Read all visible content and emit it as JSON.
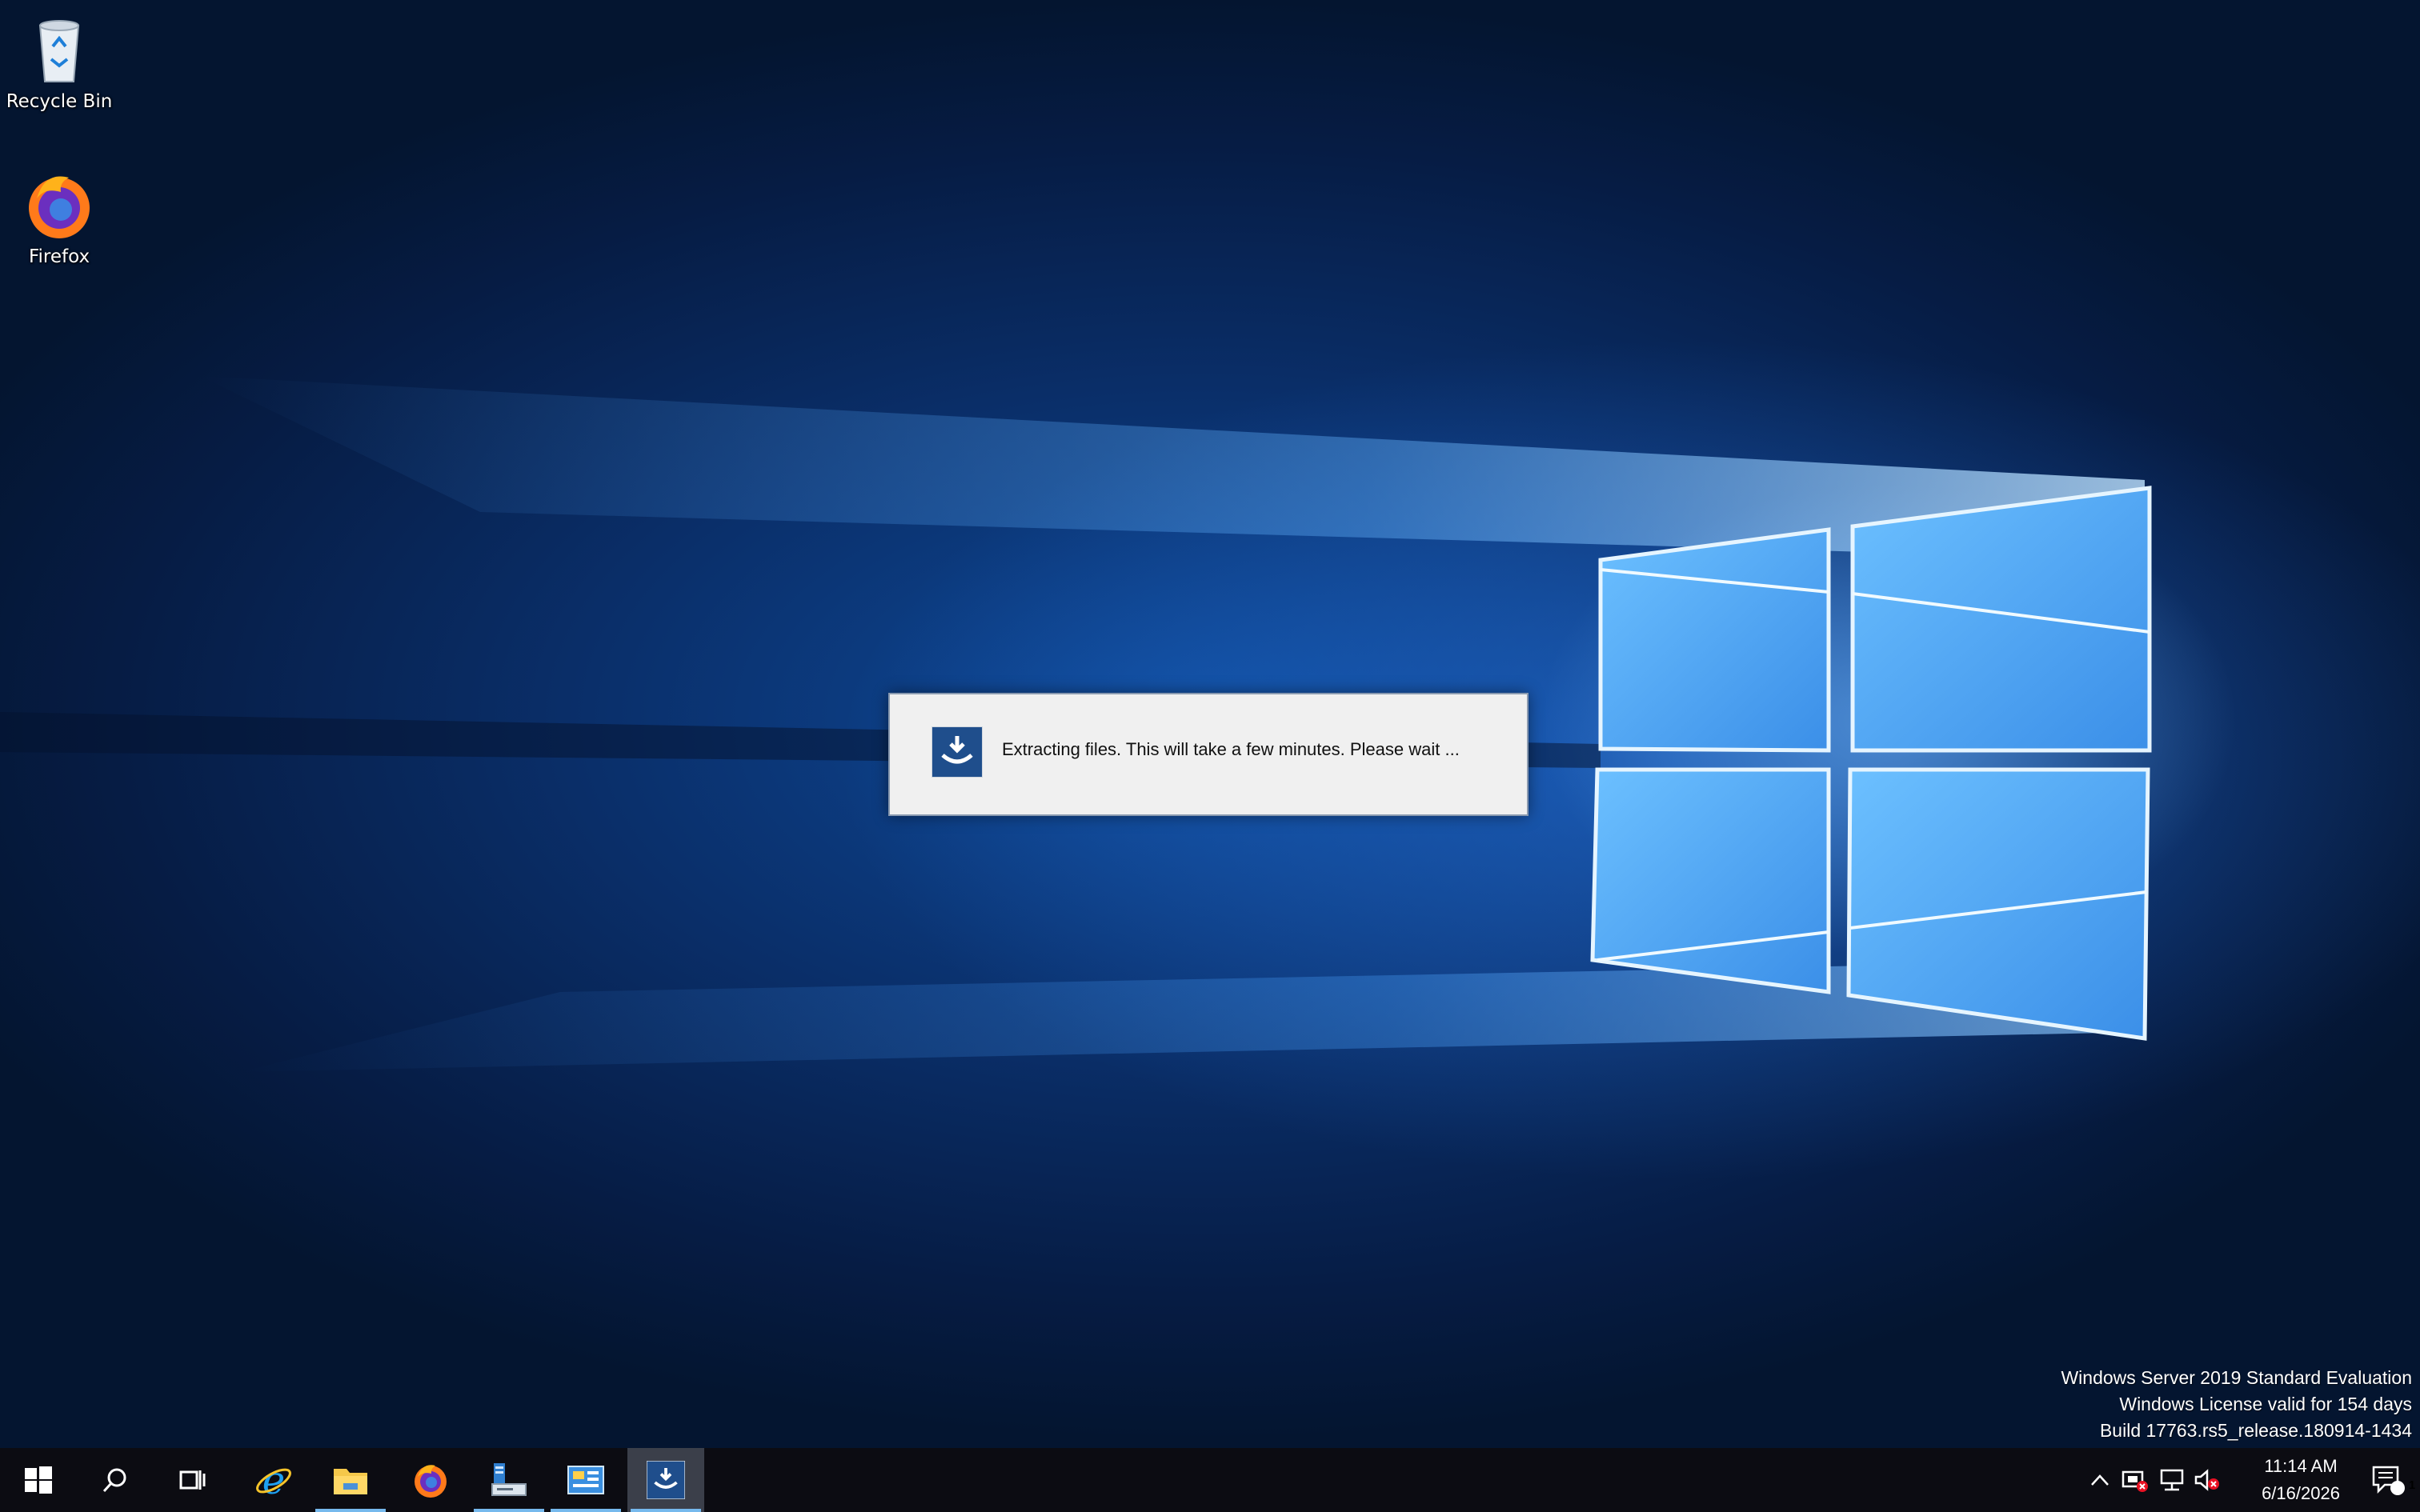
{
  "desktop": {
    "icons": [
      {
        "label": "Recycle Bin",
        "icon": "recycle-bin-icon"
      },
      {
        "label": "Firefox",
        "icon": "firefox-icon"
      }
    ]
  },
  "dialog": {
    "message": "Extracting files. This will take a few minutes. Please wait ...",
    "icon": "installer-icon"
  },
  "watermark": {
    "line1": "Windows Server 2019 Standard Evaluation",
    "line2": "Windows License valid for 154 days",
    "line3": "Build 17763.rs5_release.180914-1434"
  },
  "taskbar": {
    "buttons": [
      {
        "name": "start",
        "icon": "windows-logo-icon"
      },
      {
        "name": "search",
        "icon": "search-icon"
      },
      {
        "name": "task-view",
        "icon": "task-view-icon"
      },
      {
        "name": "internet-explorer",
        "icon": "internet-explorer-icon"
      },
      {
        "name": "file-explorer",
        "icon": "folder-icon",
        "running": true
      },
      {
        "name": "firefox",
        "icon": "firefox-icon"
      },
      {
        "name": "server-manager",
        "icon": "server-manager-icon",
        "running": true
      },
      {
        "name": "control-panel",
        "icon": "control-panel-icon",
        "running": true
      },
      {
        "name": "installer",
        "icon": "installer-icon",
        "running": true,
        "active": true
      }
    ],
    "tray": {
      "icons": [
        "chevron-up-icon",
        "security-alert-icon",
        "network-icon",
        "volume-muted-icon"
      ],
      "time": "11:14 AM",
      "date": "6/16/2026",
      "notification_count": "1"
    }
  },
  "colors": {
    "taskbar": "#0c0c12",
    "running_indicator": "#76b9ed",
    "dialog_bg": "#f0f0f0",
    "installer_icon_bg": "#1f4e8c"
  }
}
